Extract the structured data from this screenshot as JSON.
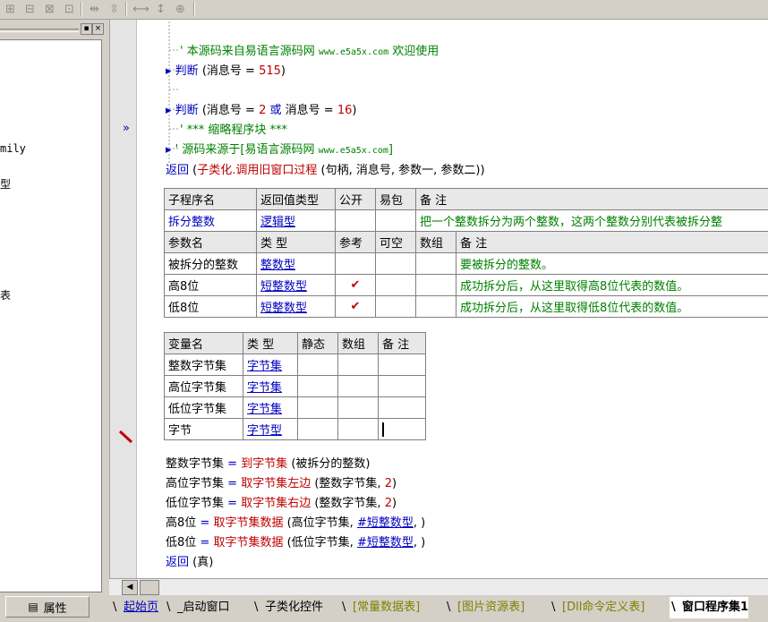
{
  "toolbar": {
    "icons": [
      "table-insert-icon",
      "table-split-icon",
      "table-merge-icon",
      "table-cols-icon",
      "col-width-icon",
      "row-height-icon",
      "fit-width-icon",
      "fit-height-icon",
      "fit-all-icon"
    ],
    "glyphs": [
      "⊞",
      "⊟",
      "⊠",
      "⊡",
      "⇹",
      "⇳",
      "⟷",
      "↕",
      "⊕"
    ]
  },
  "left_panel": {
    "items": [
      {
        "text": "mily"
      },
      {
        "text": "型"
      },
      {
        "text": "表"
      }
    ],
    "property_button": "属性",
    "win_buttons": [
      "▪",
      "×"
    ]
  },
  "code": {
    "lines": [
      {
        "prefix": "' ",
        "text": "本源码来自易语言源码网 ",
        "url": "www.e5a5x.com",
        "tail": " 欢迎使用",
        "type": "comment"
      },
      {
        "kw": "判断",
        "open": " (",
        "var": "消息号",
        "op": " = ",
        "num": "515",
        "close": ")"
      },
      {
        "kw": "判断",
        "open": " (",
        "var": "消息号",
        "op": " = ",
        "num": "2",
        "or": " 或 ",
        "var2": "消息号",
        "op2": " = ",
        "num2": "16",
        "close": ")"
      },
      {
        "text": "' *** 缩略程序块 ***",
        "type": "comment"
      },
      {
        "prefix": "' ",
        "text": "源码来源于[易语言源码网 ",
        "url": "www.e5a5x.com",
        "tail": "]",
        "type": "comment"
      },
      {
        "kw": "返回",
        "open": " (",
        "fn": "子类化.调用旧窗口过程",
        "args": " (句柄, 消息号, 参数一, 参数二))"
      }
    ],
    "sub_table": {
      "headers": [
        "子程序名",
        "返回值类型",
        "公开",
        "易包",
        "备 注"
      ],
      "row": [
        "拆分整数",
        "逻辑型",
        "",
        "",
        "把一个整数拆分为两个整数，这两个整数分别代表被拆分整"
      ],
      "param_headers": [
        "参数名",
        "类 型",
        "参考",
        "可空",
        "数组",
        "备 注"
      ],
      "params": [
        {
          "name": "被拆分的整数",
          "type": "整数型",
          "ref": "",
          "null": "",
          "arr": "",
          "note": "要被拆分的整数。"
        },
        {
          "name": "高8位",
          "type": "短整数型",
          "ref": "✔",
          "null": "",
          "arr": "",
          "note": "成功拆分后，从这里取得高8位代表的数值。"
        },
        {
          "name": "低8位",
          "type": "短整数型",
          "ref": "✔",
          "null": "",
          "arr": "",
          "note": "成功拆分后，从这里取得低8位代表的数值。"
        }
      ]
    },
    "var_table": {
      "headers": [
        "变量名",
        "类 型",
        "静态",
        "数组",
        "备 注"
      ],
      "rows": [
        {
          "name": "整数字节集",
          "type": "字节集"
        },
        {
          "name": "高位字节集",
          "type": "字节集"
        },
        {
          "name": "低位字节集",
          "type": "字节集"
        },
        {
          "name": "字节",
          "type": "字节型"
        }
      ]
    },
    "body": [
      {
        "lhs": "整数字节集",
        "op": " = ",
        "fn": "到字节集",
        "args": " (被拆分的整数)"
      },
      {
        "lhs": "高位字节集",
        "op": " = ",
        "fn": "取字节集左边",
        "args": " (整数字节集, ",
        "num": "2",
        "close": ")"
      },
      {
        "lhs": "低位字节集",
        "op": " = ",
        "fn": "取字节集右边",
        "args": " (整数字节集, ",
        "num": "2",
        "close": ")"
      },
      {
        "lhs": "高8位",
        "op": " = ",
        "fn": "取字节集数据",
        "args": " (高位字节集, ",
        "const": "#短整数型",
        "close": ", )"
      },
      {
        "lhs": "低8位",
        "op": " = ",
        "fn": "取字节集数据",
        "args": " (低位字节集, ",
        "const": "#短整数型",
        "close": ", )"
      },
      {
        "kw": "返回",
        "args": " (真)"
      }
    ]
  },
  "gutter": {
    "marker": "»"
  },
  "tabs": [
    {
      "label": "起始页",
      "color": "#0000c0",
      "active": false
    },
    {
      "label": "_启动窗口",
      "color": "#000000",
      "active": false
    },
    {
      "label": "子类化控件",
      "color": "#000000",
      "active": false
    },
    {
      "label": "[常量数据表]",
      "color": "#808000",
      "active": false
    },
    {
      "label": "[图片资源表]",
      "color": "#808000",
      "active": false
    },
    {
      "label": "[Dll命令定义表]",
      "color": "#808000",
      "active": false
    },
    {
      "label": "窗口程序集1",
      "color": "#000000",
      "active": true
    }
  ]
}
